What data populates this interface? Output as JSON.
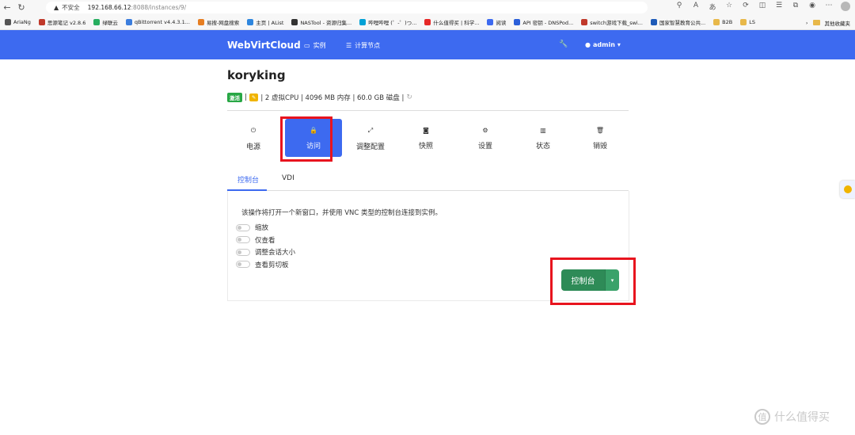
{
  "browser": {
    "insecure_label": "不安全",
    "url_host": "192.168.66.12",
    "url_path": ":8088/instances/9/",
    "bookmarks": [
      {
        "label": "AriaNg",
        "color": "#555555"
      },
      {
        "label": "思源笔记 v2.8.6",
        "color": "#c0392b"
      },
      {
        "label": "绿联云",
        "color": "#27ae60"
      },
      {
        "label": "qBittorrent v4.4.3.1...",
        "color": "#3b7ddd"
      },
      {
        "label": "易搜-网盘搜索",
        "color": "#e67e22"
      },
      {
        "label": "主页 | AList",
        "color": "#2e86de"
      },
      {
        "label": "NASTool - 资源归集...",
        "color": "#333333"
      },
      {
        "label": "哔哩哔哩 (゜-゜)つ...",
        "color": "#00a1d6"
      },
      {
        "label": "什么值得买 | 科学...",
        "color": "#e62828"
      },
      {
        "label": "阅读",
        "color": "#3d6af0"
      },
      {
        "label": "API 密钥 - DNSPod...",
        "color": "#2b5fd9"
      },
      {
        "label": "switch游戏下载_swi...",
        "color": "#c0392b"
      },
      {
        "label": "国家智慧教育公共...",
        "color": "#1e5bb8"
      },
      {
        "label": "B2B",
        "color": "#e8b84a"
      },
      {
        "label": "LS",
        "color": "#e8b84a"
      }
    ],
    "other_bookmarks": "其他收藏夹"
  },
  "navbar": {
    "brand": "WebVirtCloud",
    "instances": "实例",
    "compute_nodes": "计算节点",
    "user": "admin"
  },
  "instance": {
    "name": "koryking",
    "status_badge": "激活",
    "spec": "| 2 虚拟CPU | 4096 MB 内存 | 60.0 GB 磁盘 |"
  },
  "actions": [
    {
      "label": "电源",
      "icon": "power-icon",
      "glyph": "⏻"
    },
    {
      "label": "访问",
      "icon": "lock-icon",
      "glyph": "🔒"
    },
    {
      "label": "调整配置",
      "icon": "resize-icon",
      "glyph": "⤢"
    },
    {
      "label": "快照",
      "icon": "camera-icon",
      "glyph": "◙"
    },
    {
      "label": "设置",
      "icon": "gear-icon",
      "glyph": "⚙"
    },
    {
      "label": "状态",
      "icon": "chart-icon",
      "glyph": "▥"
    },
    {
      "label": "销毁",
      "icon": "trash-icon",
      "glyph": "🗑"
    }
  ],
  "tabs": {
    "console": "控制台",
    "vdi": "VDI"
  },
  "console_panel": {
    "description": "该操作将打开一个新窗口，并使用 VNC 类型的控制台连接到实例。",
    "options": [
      "缩放",
      "仅查看",
      "调整会话大小",
      "查看剪切板"
    ],
    "button": "控制台"
  },
  "watermark": "什么值得买",
  "colors": {
    "primary": "#3d6af0",
    "success": "#2e8b57",
    "highlight": "#e8141e"
  }
}
